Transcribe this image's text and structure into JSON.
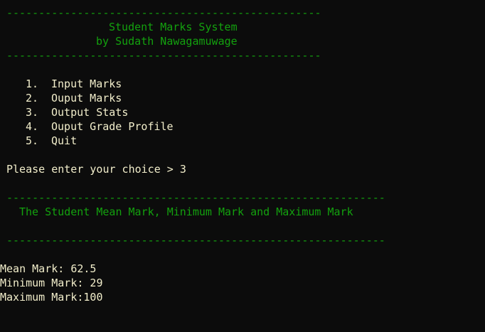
{
  "header": {
    "rule": "-------------------------------------------------",
    "title": "Student Marks System",
    "author": "by Sudath Nawagamuwage"
  },
  "menu": {
    "items": [
      {
        "number": "1.",
        "label": "Input Marks"
      },
      {
        "number": "2.",
        "label": "Ouput Marks"
      },
      {
        "number": "3.",
        "label": "Output Stats"
      },
      {
        "number": "4.",
        "label": "Ouput Grade Profile"
      },
      {
        "number": "5.",
        "label": "Quit"
      }
    ]
  },
  "prompt": {
    "text": "Please enter your choice > ",
    "value": "3"
  },
  "section": {
    "rule": "-----------------------------------------------------------",
    "title": "The Student Mean Mark, Minimum Mark and Maximum Mark"
  },
  "stats": {
    "mean": "Mean Mark: 62.5",
    "minimum": "Minimum Mark: 29",
    "maximum": "Maximum Mark:100"
  },
  "colors": {
    "background": "#0c0c0c",
    "header_green": "#13a10e",
    "text_cream": "#f2eecb"
  }
}
